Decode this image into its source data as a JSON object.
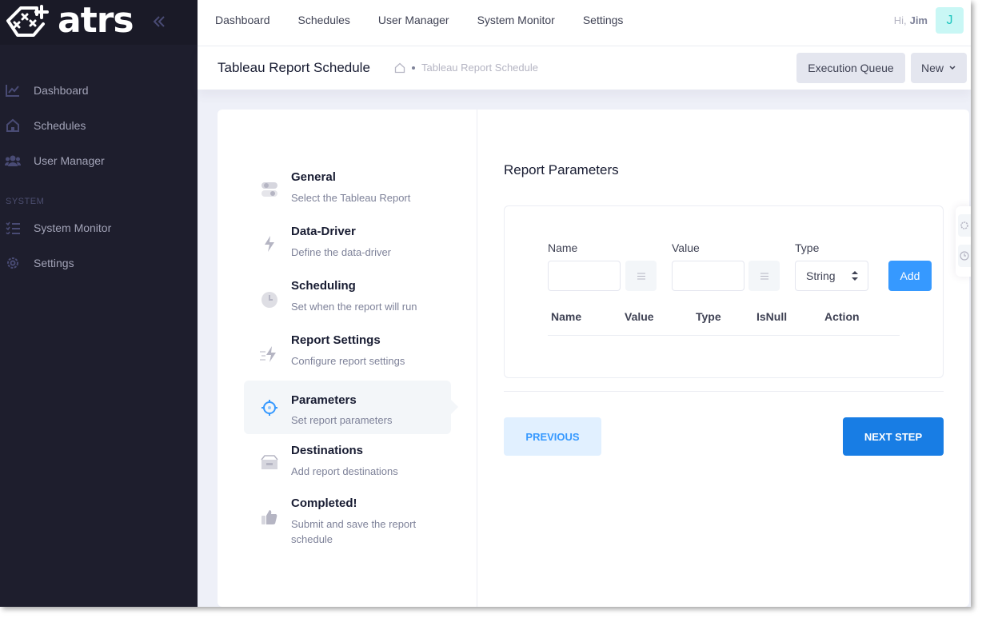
{
  "app": {
    "logo_text": "atrs"
  },
  "sidebar": {
    "items": [
      {
        "label": "Dashboard",
        "icon": "chart-line-icon"
      },
      {
        "label": "Schedules",
        "icon": "home-icon"
      },
      {
        "label": "User Manager",
        "icon": "users-icon"
      }
    ],
    "section_label": "SYSTEM",
    "system_items": [
      {
        "label": "System Monitor",
        "icon": "list-check-icon"
      },
      {
        "label": "Settings",
        "icon": "gear-icon"
      }
    ]
  },
  "topnav": {
    "items": [
      "Dashboard",
      "Schedules",
      "User Manager",
      "System Monitor",
      "Settings"
    ]
  },
  "user": {
    "greeting": "Hi,",
    "name": "Jim",
    "initial": "J"
  },
  "subheader": {
    "title": "Tableau Report Schedule",
    "breadcrumb": "Tableau Report Schedule",
    "execution_queue_label": "Execution Queue",
    "new_label": "New"
  },
  "wizard": {
    "steps": [
      {
        "title": "General",
        "desc": "Select the Tableau Report",
        "icon": "toggle-icon"
      },
      {
        "title": "Data-Driver",
        "desc": "Define the data-driver",
        "icon": "lightning-icon"
      },
      {
        "title": "Scheduling",
        "desc": "Set when the report will run",
        "icon": "clock-icon"
      },
      {
        "title": "Report Settings",
        "desc": "Configure report settings",
        "icon": "fast-lightning-icon"
      },
      {
        "title": "Parameters",
        "desc": "Set report parameters",
        "icon": "target-icon",
        "active": true
      },
      {
        "title": "Destinations",
        "desc": "Add report destinations",
        "icon": "inbox-icon"
      },
      {
        "title": "Completed!",
        "desc": "Submit and save the report schedule",
        "icon": "thumbs-up-icon"
      }
    ]
  },
  "parameters": {
    "heading": "Report Parameters",
    "name_label": "Name",
    "value_label": "Value",
    "type_label": "Type",
    "name_value": "",
    "value_value": "",
    "type_selected": "String",
    "add_label": "Add",
    "columns": [
      "Name",
      "Value",
      "Type",
      "IsNull",
      "Action"
    ]
  },
  "actions": {
    "previous_label": "PREVIOUS",
    "next_label": "NEXT STEP"
  }
}
